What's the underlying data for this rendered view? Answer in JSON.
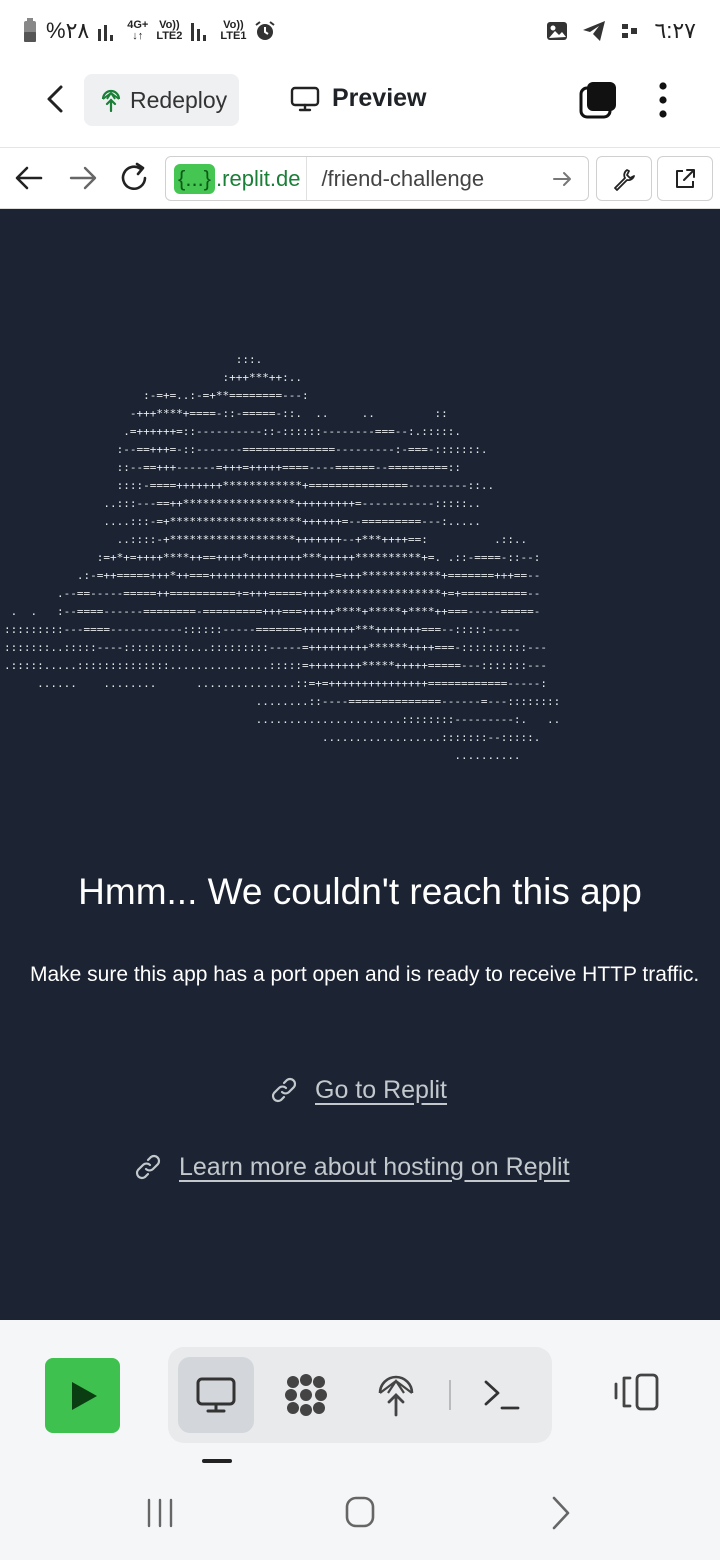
{
  "status_bar": {
    "battery": "%٢٨",
    "network1": "4G+",
    "network1_sub": "LTE2",
    "volte1": "Vo))",
    "volte2": "Vo))",
    "network2_sub": "LTE1",
    "time": "٦:٢٧"
  },
  "header": {
    "redeploy_label": "Redeploy",
    "preview_label": "Preview"
  },
  "url_bar": {
    "host_highlight": "{...}",
    "host_suffix": ".replit.de",
    "path": "/friend-challenge"
  },
  "error_page": {
    "ascii_art": "                                   :::.\n                                 :+++***++:..\n                     :-=+=..:-=+**========---:\n                   -+++****+====-::-=====-::.  ..     ..         ::\n                  .=++++++=::----------::-::::::--------===--:.:::::.\n                 :--==+++=-::-------==============---------:-===-:::::::.\n                 ::--==+++------=+++=+++++====----======--=========::\n                 ::::-====+++++++************+===============---------::..\n               ..:::---==++*****************+++++++++=-----------:::::..\n               ....:::-=+********************++++++=--=========---:.....\n                 ..::::-+*******************+++++++--+***++++==:          .::..\n              :=+*+=++++****++==++++*++++++++***+++++**********+=. .::-====-::--:\n           .:-=++=====+++*++===+++++++++++++++++++=+++************+=======+++==--\n        .--==-----=====++==========+=+++=====++++*****************+=+==========--\n .  .   :--====------========-=========+++===+++++****+*****+****++===-----=====-\n:::::::::---====-----------::::::-----=======++++++++***+++++++===--:::::-----\n:::::::..:::::----::::::::::...:::::::::-----=+++++++++******++++===-::::::::::---\n.:::::.....::::::::::::::...............:::::=++++++++*****+++++=====---:::::::---\n     ......    ........      ...............::=+=+++++++++++++++============-----:\n                                      ........::----==============------=---::::::::\n                                      ......................::::::::---------:.   ..\n                                                ..................:::::::--:::::.\n                                                                    ..........",
    "heading": "Hmm... We couldn't reach this app",
    "message": "Make sure this app has a port open and is ready to receive HTTP traffic.",
    "link1": "Go to Replit",
    "link2": "Learn more about hosting on Replit"
  },
  "icons": {
    "back": "chevron-left-icon",
    "redeploy": "deploy-icon",
    "preview": "monitor-icon",
    "tabs": "tabs-icon",
    "menu": "kebab-menu-icon",
    "run": "play-icon"
  },
  "colors": {
    "accent_green": "#3ec14f",
    "content_bg": "#1c2333",
    "link_color": "#c2c8cc"
  }
}
